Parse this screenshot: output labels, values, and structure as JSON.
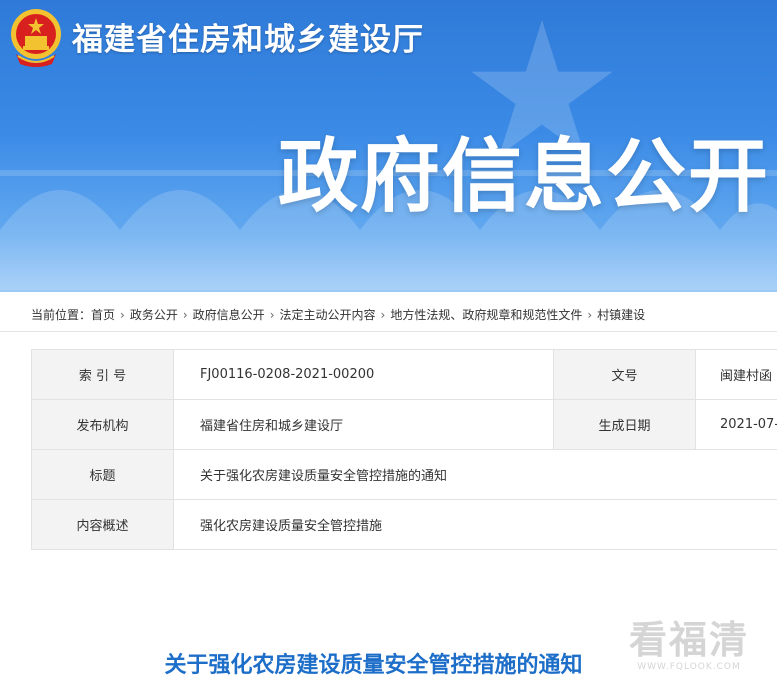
{
  "header": {
    "site_title": "福建省住房和城乡建设厅",
    "headline": "政府信息公开"
  },
  "breadcrumb": {
    "prefix": "当前位置：",
    "items": [
      "首页",
      "政务公开",
      "政府信息公开",
      "法定主动公开内容",
      "地方性法规、政府规章和规范性文件",
      "村镇建设"
    ],
    "separator": "›"
  },
  "info": {
    "index_label": "索 引 号",
    "index_value": "FJ00116-0208-2021-00200",
    "doc_no_label": "文号",
    "doc_no_value": "闽建村函",
    "publisher_label": "发布机构",
    "publisher_value": "福建省住房和城乡建设厅",
    "date_label": "生成日期",
    "date_value": "2021-07-",
    "title_label": "标题",
    "title_value": "关于强化农房建设质量安全管控措施的通知",
    "summary_label": "内容概述",
    "summary_value": "强化农房建设质量安全管控措施"
  },
  "article": {
    "title": "关于强化农房建设质量安全管控措施的通知"
  },
  "watermark": {
    "big": "看福清",
    "small": "WWW.FQLOOK.COM"
  },
  "colors": {
    "banner_top": "#2f7ad8",
    "banner_bottom": "#9ccaf7",
    "title_blue": "#1d6ec9",
    "emblem_red": "#d8201e",
    "emblem_gold": "#f2c230"
  }
}
